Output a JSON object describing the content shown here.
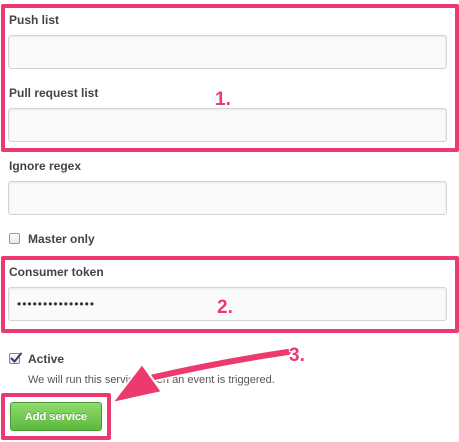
{
  "form": {
    "push_list": {
      "label": "Push list",
      "value": ""
    },
    "pull_request_list": {
      "label": "Pull request list",
      "value": ""
    },
    "ignore_regex": {
      "label": "Ignore regex",
      "value": ""
    },
    "master_only": {
      "label": "Master only",
      "checked": false
    },
    "consumer_token": {
      "label": "Consumer token",
      "value": "•••••••••••••••"
    },
    "active": {
      "label": "Active",
      "checked": true,
      "help": "We will run this service when an event is triggered."
    },
    "submit_label": "Add service"
  },
  "annotations": {
    "step1": "1.",
    "step2": "2.",
    "step3": "3."
  },
  "colors": {
    "annotation": "#ec3a6e",
    "button_green": "#5cb83c"
  }
}
